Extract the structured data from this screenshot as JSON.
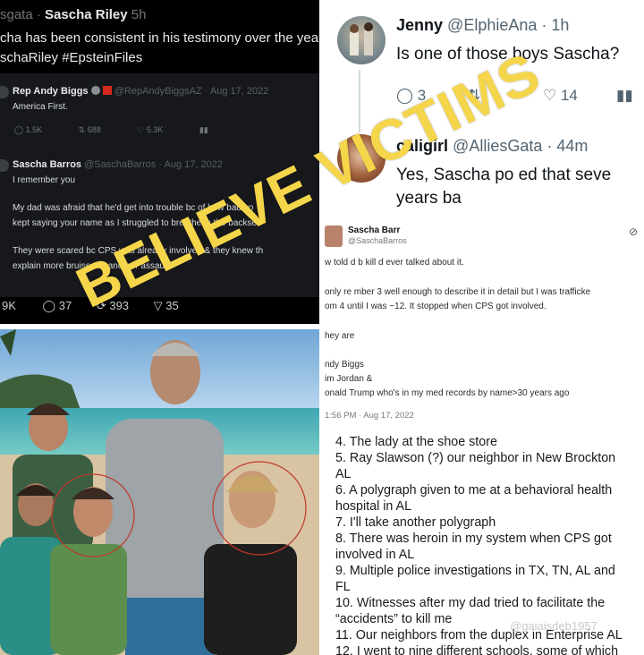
{
  "dark_tweet": {
    "header_user": "sgata",
    "header_name": "Sascha Riley",
    "header_time": "5h",
    "text_line1": "cha has been consistent in his testimony over the yea",
    "text_line2": "schaRiley #EpsteinFiles",
    "quoted": {
      "name": "Rep Andy Biggs",
      "handle_date": "@RepAndyBiggsAZ · Aug 17, 2022",
      "text": "America First.",
      "replies": "1.5K",
      "retweets": "688",
      "likes": "5.3K"
    },
    "reply": {
      "name": "Sascha Barros",
      "handle_date": "@SaschaBarros · Aug 17, 2022",
      "lines": [
        "I remember you",
        "My dad was afraid that he'd get into trouble bc of how bad yo",
        "kept saying your name as I struggled to breathe in the backse",
        "They were scared bc CPS was already involved & they knew th",
        "explain more bruises or another assault."
      ]
    },
    "stats": {
      "views": "9K",
      "replies": "37",
      "retweets": "393",
      "shares": "35"
    }
  },
  "thread": {
    "first": {
      "name": "Jenny",
      "handle_time": "@ElphieAna · 1h",
      "text": "Is one of those boys Sascha?",
      "replies": "3",
      "likes": "14"
    },
    "second": {
      "name": "caligirl",
      "handle_time": "@AlliesGata · 44m",
      "text_line1": "Yes, Sascha po     ed that seve",
      "text_line2": "years ba"
    }
  },
  "small_tweet": {
    "name": "Sascha Barr",
    "handle": "@SaschaBarros",
    "lines": [
      "w  told  d b    kill  d   ever talked about it.",
      "only re   mber 3 well enough to describe it in detail but I was trafficke",
      "om 4 until I was ~12. It stopped when CPS got involved.",
      "hey are",
      "ndy Biggs",
      "im Jordan &",
      "onald Trump who's in my med records by name>30 years ago",
      "1:56 PM · Aug 17, 2022"
    ]
  },
  "list_items": [
    "4. The lady at the shoe store",
    "5. Ray Slawson (?) our neighbor in New Brockton",
    "AL",
    "6. A polygraph given to me at a behavioral health",
    "hospital in AL",
    "7. I'll take another polygraph",
    "8. There was heroin in my system when CPS got",
    "involved in AL",
    "9. Multiple police investigations in TX, TN, AL and",
    "FL",
    "10. Witnesses after my dad tried to facilitate the",
    "“accidents” to kill me",
    "11. Our neighbors from the duplex in Enterprise AL",
    "12. I went to nine different schools, some of which"
  ],
  "watermark": "@gaiaisdeb1957",
  "overlay_text": "BELIEVE VICTIMS",
  "colors": {
    "overlay": "#f5d54a",
    "dark_bg": "#000000",
    "text_dark": "#0f1419"
  }
}
